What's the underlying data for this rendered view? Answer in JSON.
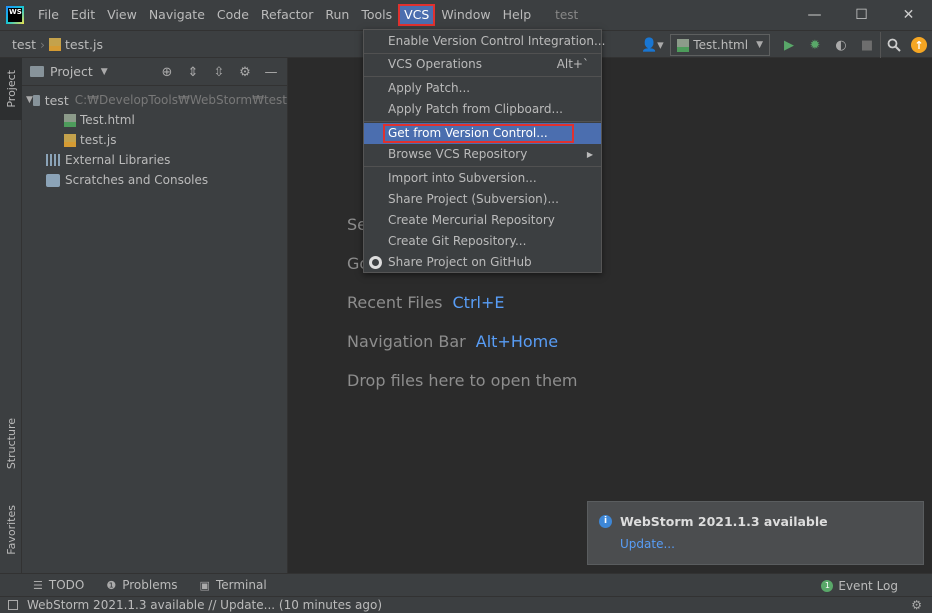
{
  "titlebar": {
    "logo_text": "WS",
    "menus": [
      "File",
      "Edit",
      "View",
      "Navigate",
      "Code",
      "Refactor",
      "Run",
      "Tools",
      "VCS",
      "Window",
      "Help"
    ],
    "project_name": "test",
    "minimize": "—",
    "maximize": "☐",
    "close": "✕"
  },
  "navbar": {
    "breadcrumb_project": "test",
    "breadcrumb_file": "test.js",
    "run_config": "Test.html"
  },
  "left_strip": {
    "project_tab": "Project",
    "structure_tab": "Structure",
    "favorites_tab": "Favorites"
  },
  "project_panel": {
    "title": "Project",
    "root_name": "test",
    "root_path": "C:₩DevelopTools₩WebStorm₩test",
    "files": [
      "Test.html",
      "test.js"
    ],
    "external_libraries": "External Libraries",
    "scratches": "Scratches and Consoles"
  },
  "editor": {
    "hint_search_partial": "Se",
    "hint_goto_partial": "Go",
    "recent_files_label": "Recent Files",
    "recent_files_key": "Ctrl+E",
    "nav_bar_label": "Navigation Bar",
    "nav_bar_key": "Alt+Home",
    "drop_files": "Drop files here to open them"
  },
  "vcs_menu": {
    "enable_vci": "Enable Version Control Integration...",
    "vcs_operations": "VCS Operations",
    "vcs_operations_shortcut": "Alt+`",
    "apply_patch": "Apply Patch...",
    "apply_patch_clipboard": "Apply Patch from Clipboard...",
    "get_from_vc": "Get from Version Control...",
    "browse_vcs": "Browse VCS Repository",
    "import_subversion": "Import into Subversion...",
    "share_subversion": "Share Project (Subversion)...",
    "create_mercurial": "Create Mercurial Repository",
    "create_git": "Create Git Repository...",
    "share_github": "Share Project on GitHub"
  },
  "notification": {
    "title": "WebStorm 2021.1.3 available",
    "link": "Update..."
  },
  "bottom_strip": {
    "todo": "TODO",
    "problems": "Problems",
    "terminal": "Terminal",
    "event_log": "Event Log",
    "event_count": "1"
  },
  "statusbar": {
    "message": "WebStorm 2021.1.3 available // Update... (10 minutes ago)"
  },
  "colors": {
    "accent": "#4b6eaf",
    "highlight_border": "#e0312f",
    "link": "#589df6",
    "run_green": "#59a869"
  }
}
